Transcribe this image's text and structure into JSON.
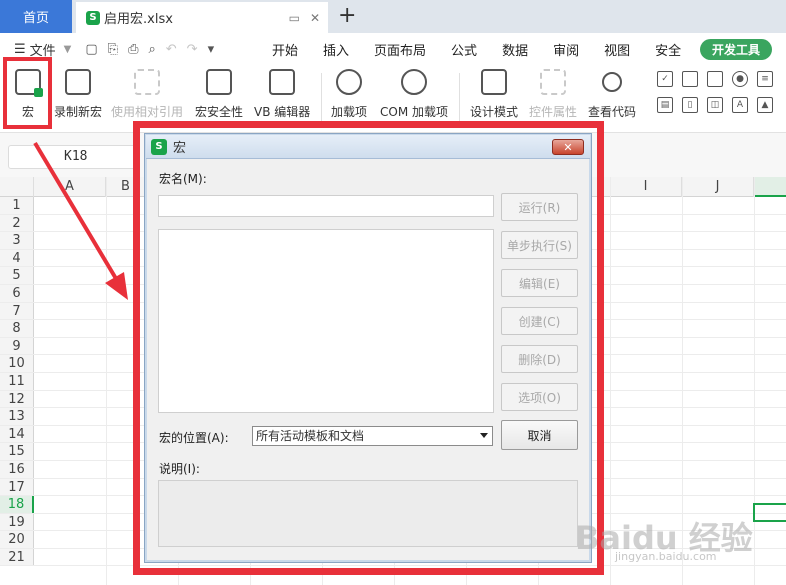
{
  "tabs": {
    "home": "首页",
    "file": "启用宏.xlsx",
    "add": "+"
  },
  "menu": {
    "file": "文件",
    "items": [
      "开始",
      "插入",
      "页面布局",
      "公式",
      "数据",
      "审阅",
      "视图",
      "安全"
    ],
    "active": "开发工具"
  },
  "ribbon": {
    "buttons": [
      {
        "label": "宏",
        "icon": "macro-icon"
      },
      {
        "label": "录制新宏",
        "icon": "record-macro-icon"
      },
      {
        "label": "使用相对引用",
        "icon": "relative-reference-icon"
      },
      {
        "label": "宏安全性",
        "icon": "macro-security-icon"
      },
      {
        "label": "VB 编辑器",
        "icon": "vb-editor-icon"
      },
      {
        "label": "加载项",
        "icon": "addins-gear-icon"
      },
      {
        "label": "COM 加载项",
        "icon": "com-addins-icon"
      },
      {
        "label": "设计模式",
        "icon": "design-mode-icon"
      },
      {
        "label": "控件属性",
        "icon": "control-properties-icon"
      },
      {
        "label": "查看代码",
        "icon": "view-code-icon"
      }
    ]
  },
  "formula": {
    "cell_ref": "K18"
  },
  "sheet": {
    "columns": [
      "A",
      "B",
      "I",
      "J"
    ],
    "rows": [
      "1",
      "2",
      "3",
      "4",
      "5",
      "6",
      "7",
      "8",
      "9",
      "10",
      "11",
      "12",
      "13",
      "14",
      "15",
      "16",
      "17",
      "18",
      "19",
      "20",
      "21"
    ],
    "active_row": "18"
  },
  "dialog": {
    "title": "宏",
    "close": "✕",
    "name_label": "宏名(M):",
    "name_value": "",
    "buttons": {
      "run": "运行(R)",
      "step": "单步执行(S)",
      "edit": "编辑(E)",
      "create": "创建(C)",
      "delete": "删除(D)",
      "options": "选项(O)",
      "cancel": "取消"
    },
    "location_label": "宏的位置(A):",
    "location_value": "所有活动模板和文档",
    "description_label": "说明(I):",
    "description_value": ""
  },
  "watermark": {
    "main": "Baidu 经验",
    "sub": "jingyan.baidu.com"
  },
  "colors": {
    "accent_green": "#1aa34a",
    "highlight_red": "#e8303a",
    "tab_blue": "#3b78d8"
  }
}
